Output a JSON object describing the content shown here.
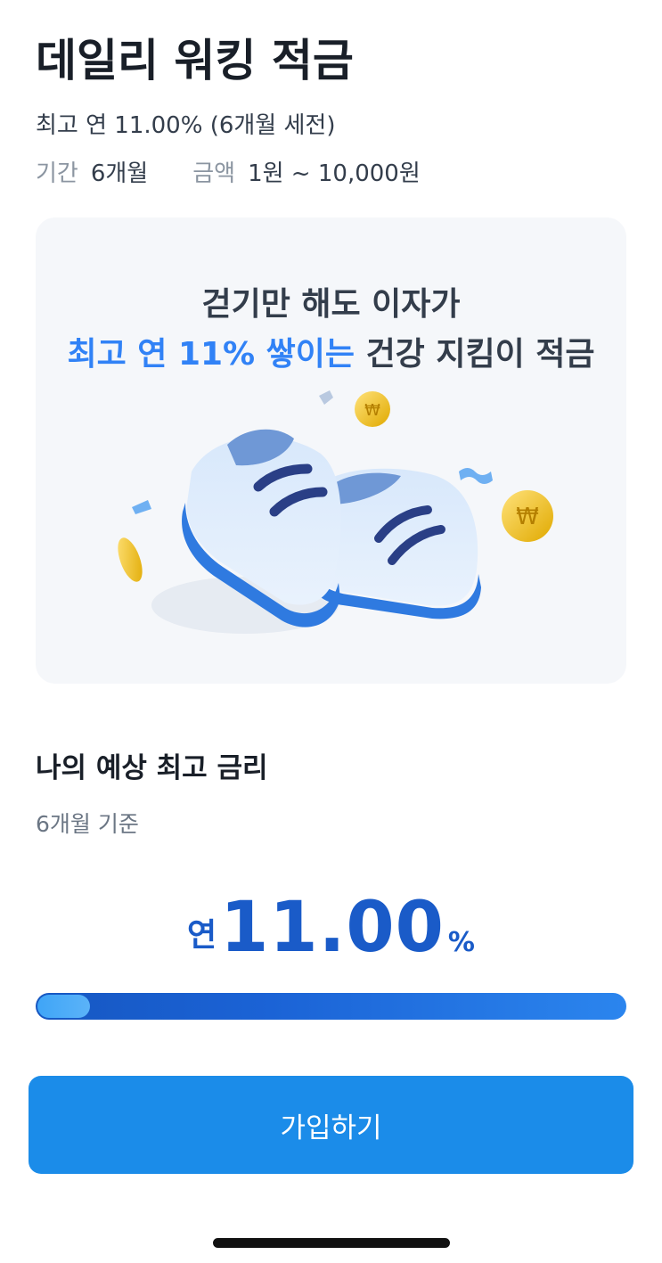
{
  "header": {
    "title": "데일리 워킹 적금",
    "rate_summary": "최고 연 11.00% (6개월 세전)",
    "period_label": "기간",
    "period_value": "6개월",
    "amount_label": "금액",
    "amount_value": "1원 ~ 10,000원"
  },
  "hero": {
    "line1": "걷기만 해도 이자가",
    "line2_accent": "최고 연 11% 쌓이는",
    "line2_rest": "건강 지킴이 적금",
    "illustration_icons": [
      "sneakers-icon",
      "coin-icon",
      "confetti-icon"
    ]
  },
  "rate_section": {
    "title": "나의 예상 최고 금리",
    "subtitle": "6개월 기준",
    "rate_prefix": "연",
    "rate_value": "11.00",
    "rate_unit": "%",
    "progress_fraction": 0.09
  },
  "cta": {
    "join_label": "가입하기"
  },
  "colors": {
    "accent": "#3182f6",
    "rate_text": "#1a5bc8",
    "button": "#1b8ce9",
    "hero_bg": "#f5f7fa"
  }
}
